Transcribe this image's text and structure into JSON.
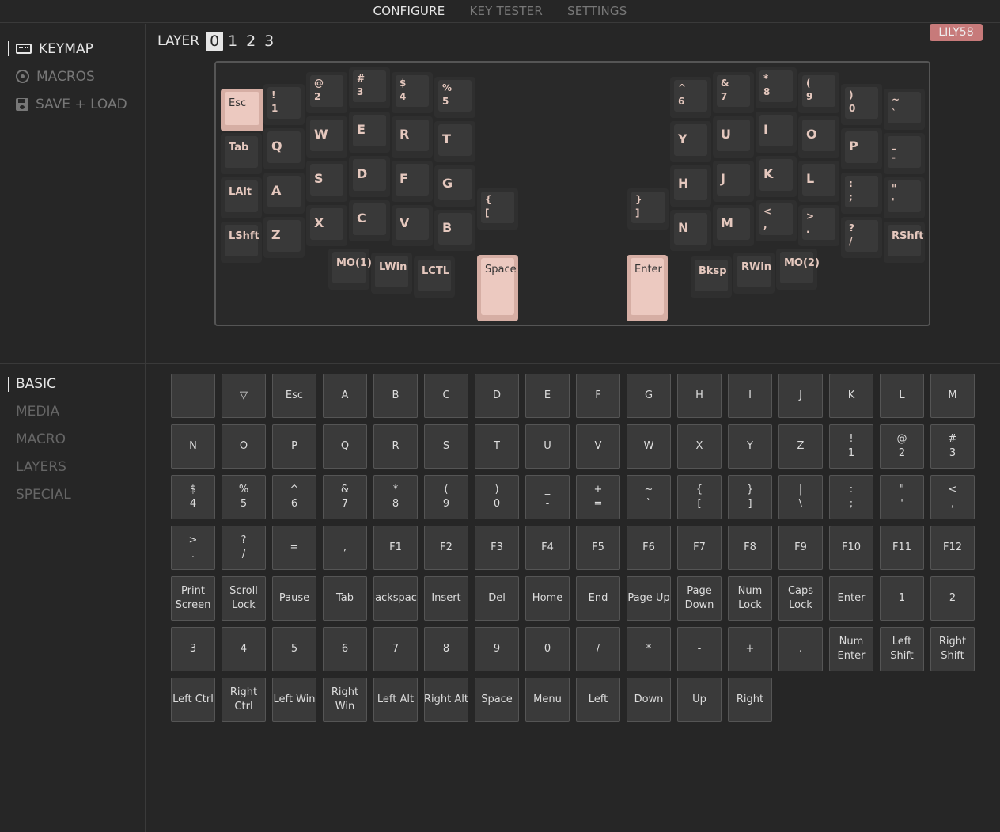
{
  "topnav": {
    "tabs": [
      "CONFIGURE",
      "KEY TESTER",
      "SETTINGS"
    ],
    "active": 0
  },
  "sidebar": {
    "items": [
      {
        "label": "KEYMAP",
        "icon": "keyboard-icon",
        "active": true
      },
      {
        "label": "MACROS",
        "icon": "macro-icon",
        "active": false
      },
      {
        "label": "SAVE + LOAD",
        "icon": "save-icon",
        "active": false
      }
    ]
  },
  "categories": {
    "items": [
      "BASIC",
      "MEDIA",
      "MACRO",
      "LAYERS",
      "SPECIAL"
    ],
    "active": 0
  },
  "layer": {
    "label": "LAYER",
    "numbers": [
      "0",
      "1",
      "2",
      "3"
    ],
    "active": 0
  },
  "board_name": "LILY58",
  "keymap": [
    "Esc",
    "!\n1",
    "@\n2",
    "#\n3",
    "$\n4",
    "%\n5",
    "Tab",
    "Q",
    "W",
    "E",
    "R",
    "T",
    "LAlt",
    "A",
    "S",
    "D",
    "F",
    "G",
    "LShft",
    "Z",
    "X",
    "C",
    "V",
    "B",
    "{\n[",
    "MO(1)",
    "LWin",
    "LCTL",
    "Space",
    "^\n6",
    "&\n7",
    "*\n8",
    "(\n9",
    ")\n0",
    "~\n`",
    "Y",
    "U",
    "I",
    "O",
    "P",
    "_\n-",
    "H",
    "J",
    "K",
    "L",
    ":\n;",
    "\"\n'",
    "}\n]",
    "N",
    "M",
    "<\n,",
    ">\n.",
    "?\n/",
    "RShft",
    "Enter",
    "Bksp",
    "RWin",
    "MO(2)"
  ],
  "palette": [
    "",
    "▽",
    "Esc",
    "A",
    "B",
    "C",
    "D",
    "E",
    "F",
    "G",
    "H",
    "I",
    "J",
    "K",
    "L",
    "M",
    "N",
    "O",
    "P",
    "Q",
    "R",
    "S",
    "T",
    "U",
    "V",
    "W",
    "X",
    "Y",
    "Z",
    "!\n1",
    "@\n2",
    "#\n3",
    "$\n4",
    "%\n5",
    "^\n6",
    "&\n7",
    "*\n8",
    "(\n9",
    ")\n0",
    "_\n-",
    "+\n=",
    "~\n`",
    "{\n[",
    "}\n]",
    "|\n\\",
    ":\n;",
    "\"\n'",
    "<\n,",
    ">\n.",
    "?\n/",
    "=",
    ",",
    "F1",
    "F2",
    "F3",
    "F4",
    "F5",
    "F6",
    "F7",
    "F8",
    "F9",
    "F10",
    "F11",
    "F12",
    "Print\nScreen",
    "Scroll\nLock",
    "Pause",
    "Tab",
    "Backspace",
    "Insert",
    "Del",
    "Home",
    "End",
    "Page Up",
    "Page\nDown",
    "Num\nLock",
    "Caps\nLock",
    "Enter",
    "1",
    "2",
    "3",
    "4",
    "5",
    "6",
    "7",
    "8",
    "9",
    "0",
    "/",
    "*",
    "-",
    "+",
    ".",
    "Num\nEnter",
    "Left\nShift",
    "Right\nShift",
    "Left Ctrl",
    "Right\nCtrl",
    "Left Win",
    "Right\nWin",
    "Left Alt",
    "Right Alt",
    "Space",
    "Menu",
    "Left",
    "Down",
    "Up",
    "Right"
  ]
}
